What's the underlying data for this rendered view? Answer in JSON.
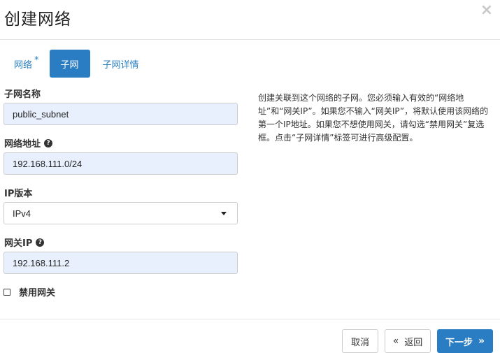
{
  "modal": {
    "title": "创建网络",
    "close_glyph": "×"
  },
  "tabs": [
    {
      "label": "网络",
      "required_mark": "*",
      "active": false
    },
    {
      "label": "子网",
      "active": true
    },
    {
      "label": "子网详情",
      "active": false
    }
  ],
  "form": {
    "subnet_name": {
      "label": "子网名称",
      "value": "public_subnet"
    },
    "network_address": {
      "label": "网络地址",
      "help_glyph": "?",
      "value": "192.168.111.0/24"
    },
    "ip_version": {
      "label": "IP版本",
      "selected": "IPv4"
    },
    "gateway_ip": {
      "label": "网关IP",
      "help_glyph": "?",
      "value": "192.168.111.2"
    },
    "disable_gateway": {
      "label": "禁用网关",
      "checked": false
    }
  },
  "help_text": "创建关联到这个网络的子网。您必须输入有效的“网络地址”和“网关IP”。如果您不输入“网关IP”，将默认使用该网络的第一个IP地址。如果您不想使用网关，请勾选“禁用网关”复选框。点击“子网详情”标签可进行高级配置。",
  "footer": {
    "cancel_label": "取消",
    "back_chevron": "«",
    "back_label": "返回",
    "next_label": "下一步",
    "next_chevron": "»"
  },
  "colors": {
    "primary": "#2a7dc2",
    "link": "#2b7fbf",
    "autofill_bg": "#e8f0fe"
  }
}
